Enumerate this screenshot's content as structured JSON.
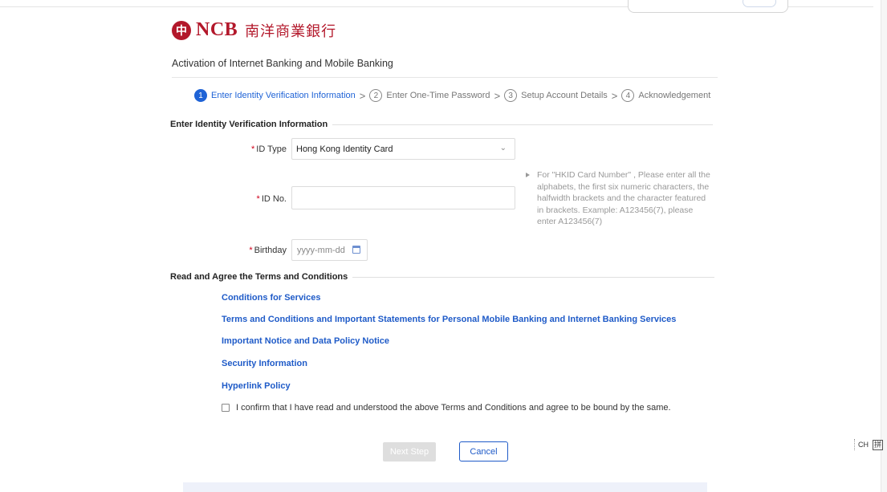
{
  "brand": {
    "mark_glyph": "中",
    "name_en": "NCB",
    "name_cn": "南洋商業銀行",
    "color": "#b3182b"
  },
  "page_title": "Activation of Internet Banking and Mobile Banking",
  "steps": [
    {
      "num": "1",
      "label": "Enter Identity Verification Information",
      "active": true
    },
    {
      "num": "2",
      "label": "Enter One-Time Password",
      "active": false
    },
    {
      "num": "3",
      "label": "Setup Account Details",
      "active": false
    },
    {
      "num": "4",
      "label": "Acknowledgement",
      "active": false
    }
  ],
  "step_separator": ">",
  "identity_section": {
    "heading": "Enter Identity Verification Information",
    "required_mark": "*",
    "id_type": {
      "label": "ID Type",
      "value": "Hong Kong Identity Card"
    },
    "id_no": {
      "label": "ID No.",
      "value": ""
    },
    "birthday": {
      "label": "Birthday",
      "placeholder": "yyyy-mm-dd"
    },
    "hint": "For \"HKID Card Number\" , Please enter all the alphabets, the first six numeric characters, the halfwidth brackets and the character featured in brackets. Example: A123456(7), please enter A123456(7)"
  },
  "terms_section": {
    "heading": "Read and Agree the Terms and Conditions",
    "links": [
      "Conditions for Services",
      "Terms and Conditions and Important Statements for Personal Mobile Banking and Internet Banking Services",
      "Important Notice and Data Policy Notice",
      "Security Information",
      "Hyperlink Policy"
    ],
    "confirm_text": "I confirm that I have read and understood the above Terms and Conditions and agree to be bound by the same."
  },
  "buttons": {
    "next": "Next Step",
    "cancel": "Cancel"
  },
  "ime": {
    "lang": "CH",
    "mode": "拼"
  },
  "colors": {
    "accent": "#1f63d6",
    "link": "#1f5bc8",
    "required": "#d0021b",
    "disabled": "#dedede"
  }
}
